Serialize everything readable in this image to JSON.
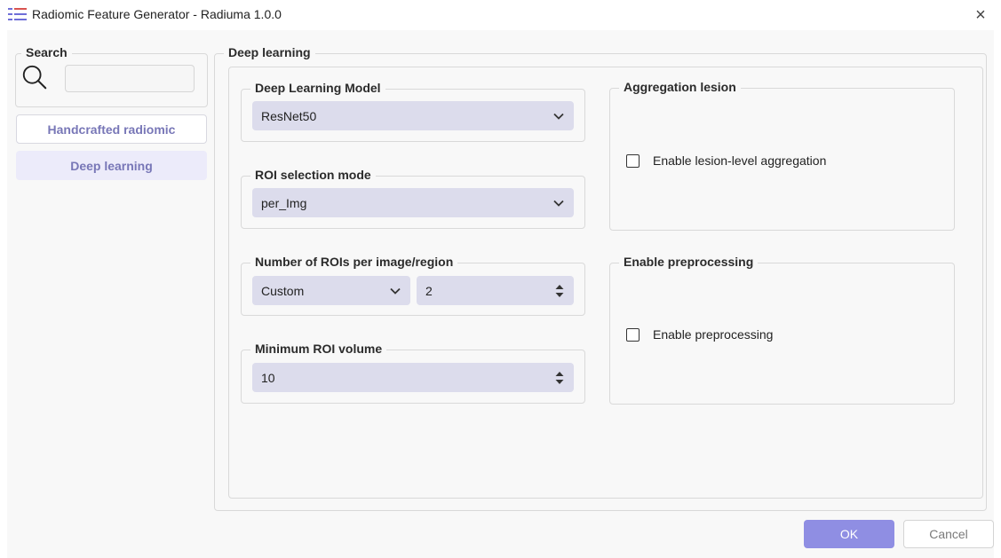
{
  "window": {
    "title": "Radiomic Feature Generator - Radiuma 1.0.0",
    "close_glyph": "×",
    "app_icon": "list-icon"
  },
  "sidebar": {
    "search": {
      "title": "Search",
      "value": "",
      "placeholder": ""
    },
    "items": [
      {
        "label": "Handcrafted radiomic",
        "active": false
      },
      {
        "label": "Deep learning",
        "active": true
      }
    ]
  },
  "main": {
    "title": "Deep learning",
    "model": {
      "title": "Deep Learning Model",
      "value": "ResNet50"
    },
    "roi_mode": {
      "title": "ROI selection mode",
      "value": "per_Img"
    },
    "num_rois": {
      "title": "Number of ROIs per image/region",
      "mode": "Custom",
      "count": "2"
    },
    "min_roi_volume": {
      "title": "Minimum ROI volume",
      "value": "10"
    },
    "aggregation": {
      "title": "Aggregation lesion",
      "checkbox_label": "Enable lesion-level aggregation",
      "checked": false
    },
    "preprocessing": {
      "title": "Enable preprocessing",
      "checkbox_label": "Enable preprocessing",
      "checked": false
    }
  },
  "footer": {
    "ok_label": "OK",
    "cancel_label": "Cancel"
  },
  "colors": {
    "accent": "#8f8ee3",
    "accent_text": "#7877b7",
    "combo_bg": "#dcdcec",
    "active_item_bg": "#ecebfa"
  }
}
